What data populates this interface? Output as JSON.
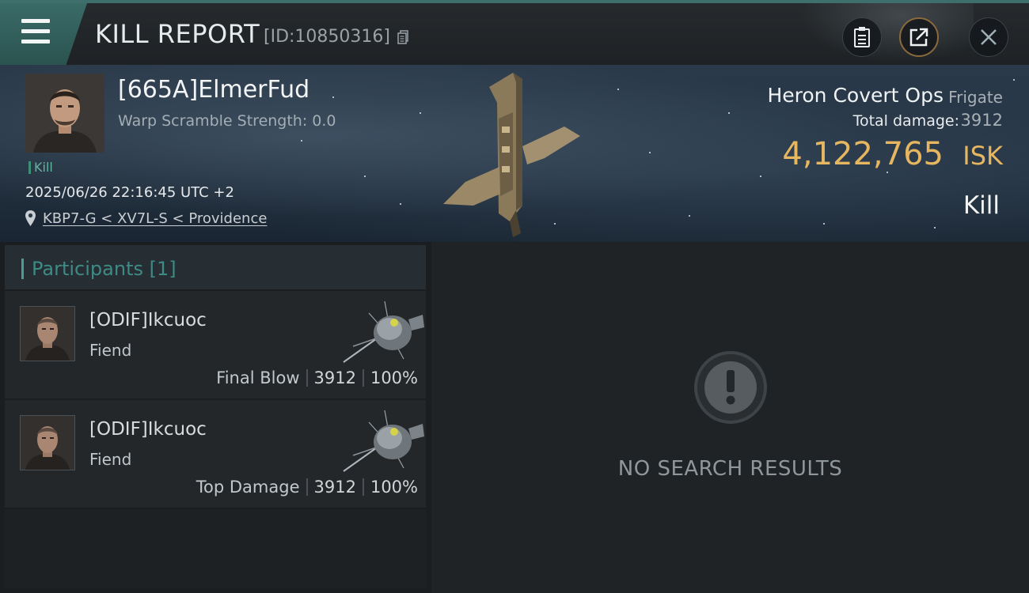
{
  "header": {
    "title": "KILL REPORT",
    "report_id": "[ID:10850316]",
    "buttons": [
      {
        "icon": "clipboard-icon"
      },
      {
        "icon": "share-icon"
      },
      {
        "icon": "close-icon"
      }
    ]
  },
  "victim": {
    "name": "[665A]ElmerFud",
    "warp_scramble": "Warp Scramble Strength: 0.0",
    "status_tag": "Kill",
    "timestamp": "2025/06/26 22:16:45 UTC +2",
    "location": "KBP7-G < XV7L-S < Providence",
    "ship_name": "Heron Covert Ops",
    "ship_class": "Frigate",
    "total_damage_label": "Total damage:",
    "total_damage": "3912",
    "isk_value": "4,122,765",
    "isk_unit": "ISK",
    "kill_type": "Kill"
  },
  "participants": {
    "header": "Participants [1]",
    "items": [
      {
        "name": "[ODIF]Ikcuoc",
        "ship": "Fiend",
        "role": "Final Blow",
        "damage": "3912",
        "percent": "100%"
      },
      {
        "name": "[ODIF]Ikcuoc",
        "ship": "Fiend",
        "role": "Top Damage",
        "damage": "3912",
        "percent": "100%"
      }
    ]
  },
  "results": {
    "empty_text": "NO SEARCH RESULTS"
  },
  "colors": {
    "accent_teal": "#3f8f78",
    "isk_gold": "#e7b760",
    "background": "#1c1f22"
  }
}
